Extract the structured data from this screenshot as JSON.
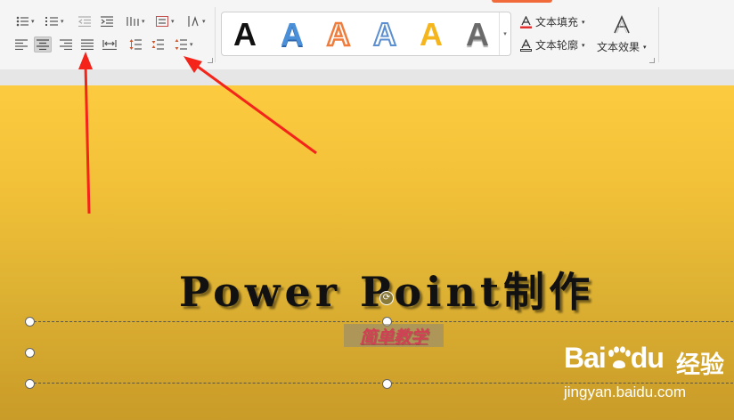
{
  "ribbon": {
    "text_fill_label": "文本填充",
    "text_outline_label": "文本轮廓",
    "text_effects_label": "文本效果",
    "art_style_glyph": "A",
    "art_styles": [
      {
        "name": "black-solid",
        "color": "#111111"
      },
      {
        "name": "blue-gradient",
        "color": "#4a8fd8"
      },
      {
        "name": "orange-outline",
        "color": "#f07c3c"
      },
      {
        "name": "blue-outline",
        "color": "#5b8fd0"
      },
      {
        "name": "gold-solid",
        "color": "#f5b51d"
      },
      {
        "name": "gray-gradient",
        "color": "#6a6a6a"
      }
    ]
  },
  "slide": {
    "title": "Power Point制作",
    "subtitle": "简单教学"
  },
  "watermark": {
    "logo_bai": "Bai",
    "logo_du": "du",
    "cn": "经验",
    "url": "jingyan.baidu.com"
  },
  "colors": {
    "arrow": "#f4241a",
    "accent": "#f06a3a"
  }
}
